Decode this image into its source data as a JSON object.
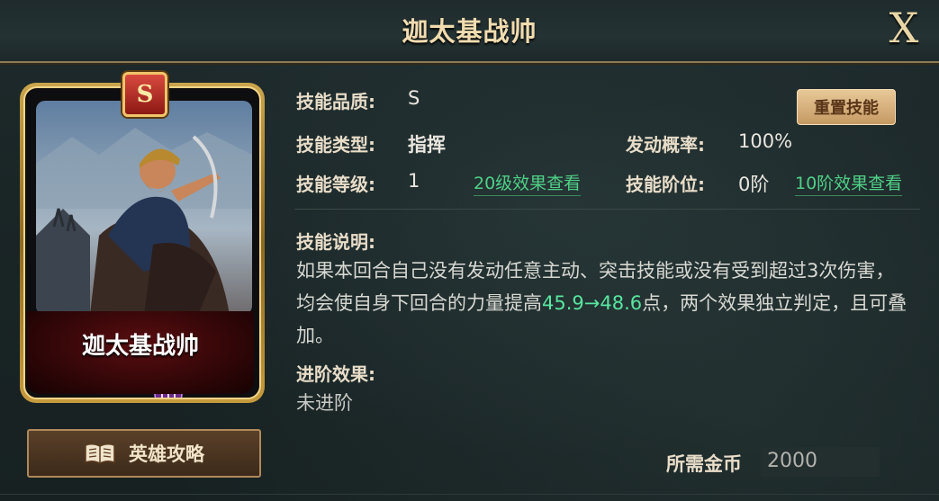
{
  "header": {
    "title": "迦太基战帅",
    "close_label": "X"
  },
  "card": {
    "grade": "S",
    "name": "迦太基战帅"
  },
  "guide_button": {
    "label": "英雄攻略"
  },
  "skill": {
    "quality_label": "技能品质:",
    "quality_value": "S",
    "type_label": "技能类型:",
    "type_value": "指挥",
    "level_label": "技能等级:",
    "level_value": "1",
    "level_link": "20级效果查看",
    "chance_label": "发动概率:",
    "chance_value": "100%",
    "tier_label": "技能阶位:",
    "tier_value": "0阶",
    "tier_link": "10阶效果查看",
    "reset_label": "重置技能",
    "desc_label": "技能说明:",
    "desc_part1": "如果本回合自己没有发动任意主动、突击技能或没有受到超过3次伤害，均会使自身下回合的力量提高",
    "desc_highlight": "45.9→48.6",
    "desc_part2": "点，两个效果独立判定，且可叠加。",
    "advance_label": "进阶效果:",
    "advance_value": "未进阶"
  },
  "cost": {
    "label": "所需金币",
    "value": "2000"
  },
  "colors": {
    "accent_green": "#4fd087",
    "highlight": "#58e6a0",
    "gold": "#f1dcb0"
  }
}
